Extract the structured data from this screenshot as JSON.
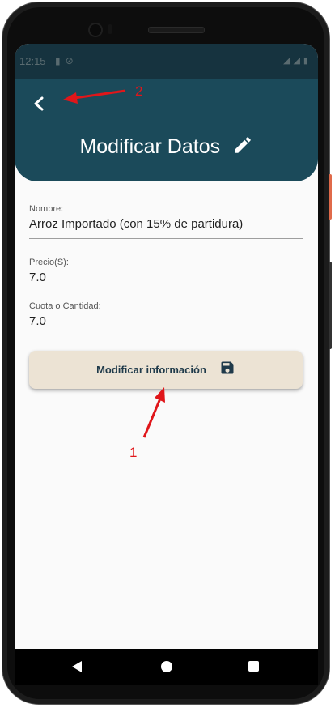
{
  "status_bar": {
    "time": "12:15"
  },
  "app_bar": {
    "title": "Modificar Datos"
  },
  "form": {
    "fields": [
      {
        "label": "Nombre:",
        "value": "Arroz Importado (con 15% de partidura)"
      },
      {
        "label": "Precio(S):",
        "value": "7.0"
      },
      {
        "label": "Cuota o Cantidad:",
        "value": "7.0"
      }
    ],
    "submit_label": "Modificar información"
  },
  "annotations": {
    "label_1": "1",
    "label_2": "2"
  },
  "colors": {
    "app_bar": "#1b4a5a",
    "button": "#ece3d4",
    "annotation": "#e0161a"
  }
}
